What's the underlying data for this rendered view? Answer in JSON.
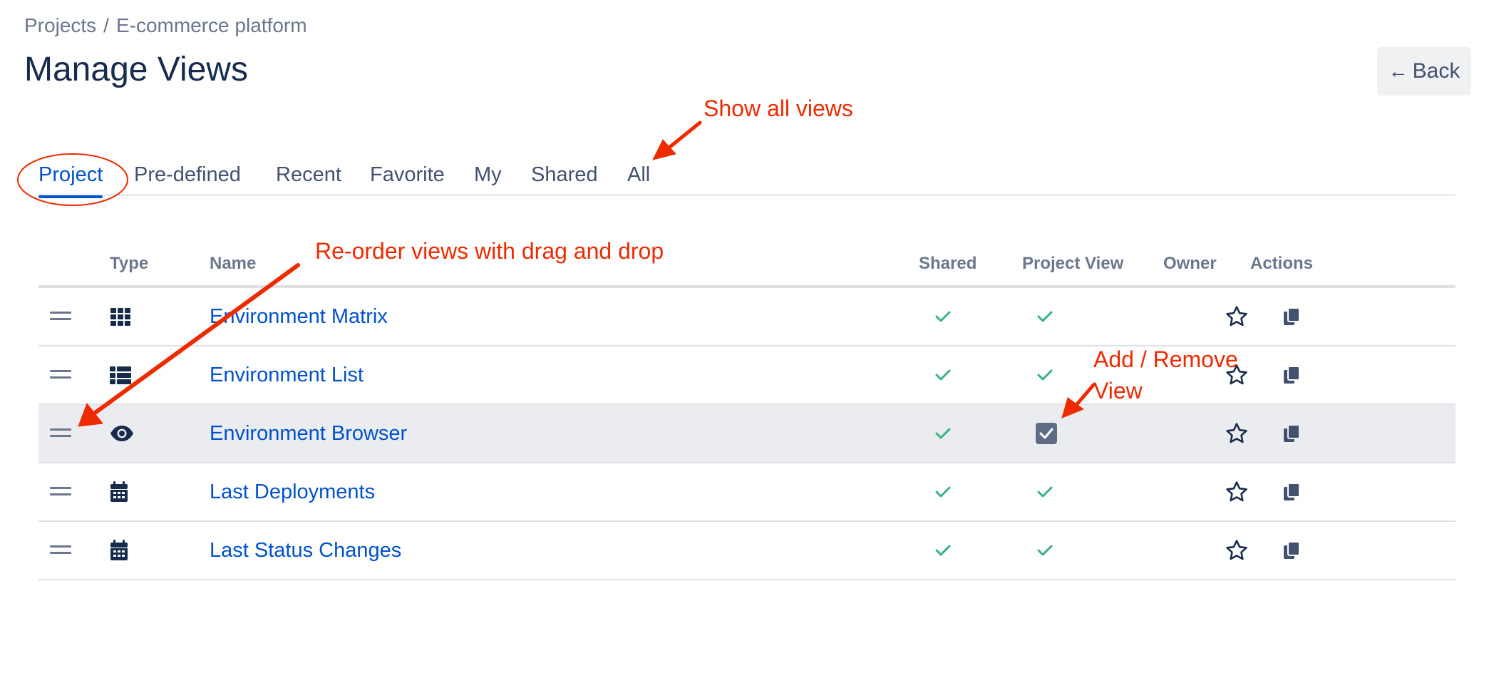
{
  "breadcrumb": {
    "projects": "Projects",
    "separator": "/",
    "current": "E-commerce platform"
  },
  "page_title": "Manage Views",
  "back_button": {
    "arrow": "←",
    "label": "Back"
  },
  "tabs": [
    {
      "label": "Project",
      "active": true
    },
    {
      "label": "Pre-defined"
    },
    {
      "label": "Recent"
    },
    {
      "label": "Favorite"
    },
    {
      "label": "My"
    },
    {
      "label": "Shared"
    },
    {
      "label": "All"
    }
  ],
  "table": {
    "headers": {
      "type": "Type",
      "name": "Name",
      "shared": "Shared",
      "project_view": "Project View",
      "owner": "Owner",
      "actions": "Actions"
    },
    "rows": [
      {
        "type_icon": "grid-icon",
        "name": "Environment Matrix",
        "shared": true,
        "project_view": true,
        "highlighted": false
      },
      {
        "type_icon": "list-icon",
        "name": "Environment List",
        "shared": true,
        "project_view": true,
        "highlighted": false
      },
      {
        "type_icon": "eye-icon",
        "name": "Environment Browser",
        "shared": true,
        "project_view": "checkbox-checked",
        "highlighted": true
      },
      {
        "type_icon": "calendar-icon",
        "name": "Last Deployments",
        "shared": true,
        "project_view": true,
        "highlighted": false
      },
      {
        "type_icon": "calendar-icon",
        "name": "Last Status Changes",
        "shared": true,
        "project_view": true,
        "highlighted": false
      }
    ]
  },
  "annotations": {
    "show_all": "Show all views",
    "reorder": "Re-order views with drag and drop",
    "add_remove_line1": "Add / Remove",
    "add_remove_line2": "View"
  },
  "colors": {
    "link": "#0052cc",
    "check": "#36b37e",
    "annotation": "#ee2a00",
    "title": "#172b4d"
  }
}
